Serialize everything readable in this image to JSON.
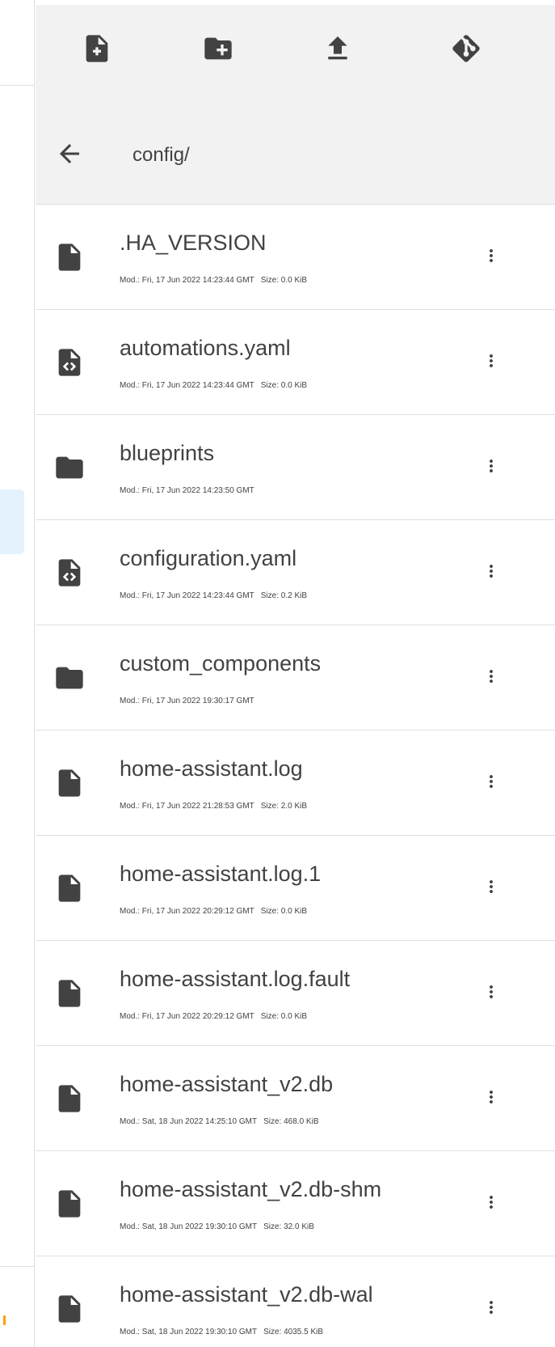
{
  "toolbar": {
    "icons": [
      "new-file-icon",
      "new-folder-icon",
      "upload-icon",
      "git-icon"
    ]
  },
  "pathbar": {
    "path": "config/",
    "back_icon": "arrow-left-icon"
  },
  "files": [
    {
      "name": ".HA_VERSION",
      "type": "file",
      "modified": "Mod.: Fri, 17 Jun 2022 14:23:44 GMT",
      "size": "Size: 0.0 KiB"
    },
    {
      "name": "automations.yaml",
      "type": "code",
      "modified": "Mod.: Fri, 17 Jun 2022 14:23:44 GMT",
      "size": "Size: 0.0 KiB"
    },
    {
      "name": "blueprints",
      "type": "folder",
      "modified": "Mod.: Fri, 17 Jun 2022 14:23:50 GMT",
      "size": ""
    },
    {
      "name": "configuration.yaml",
      "type": "code",
      "modified": "Mod.: Fri, 17 Jun 2022 14:23:44 GMT",
      "size": "Size: 0.2 KiB"
    },
    {
      "name": "custom_components",
      "type": "folder",
      "modified": "Mod.: Fri, 17 Jun 2022 19:30:17 GMT",
      "size": ""
    },
    {
      "name": "home-assistant.log",
      "type": "file",
      "modified": "Mod.: Fri, 17 Jun 2022 21:28:53 GMT",
      "size": "Size: 2.0 KiB"
    },
    {
      "name": "home-assistant.log.1",
      "type": "file",
      "modified": "Mod.: Fri, 17 Jun 2022 20:29:12 GMT",
      "size": "Size: 0.0 KiB"
    },
    {
      "name": "home-assistant.log.fault",
      "type": "file",
      "modified": "Mod.: Fri, 17 Jun 2022 20:29:12 GMT",
      "size": "Size: 0.0 KiB"
    },
    {
      "name": "home-assistant_v2.db",
      "type": "file",
      "modified": "Mod.: Sat, 18 Jun 2022 14:25:10 GMT",
      "size": "Size: 468.0 KiB"
    },
    {
      "name": "home-assistant_v2.db-shm",
      "type": "file",
      "modified": "Mod.: Sat, 18 Jun 2022 19:30:10 GMT",
      "size": "Size: 32.0 KiB"
    },
    {
      "name": "home-assistant_v2.db-wal",
      "type": "file",
      "modified": "Mod.: Sat, 18 Jun 2022 19:30:10 GMT",
      "size": "Size: 4035.5 KiB"
    }
  ],
  "colors": {
    "header_bg": "#f2f2f2",
    "icon": "#424242",
    "divider": "#e0e0e0",
    "selected_highlight": "#e3f2fd",
    "accent_orange": "#ffa000"
  }
}
